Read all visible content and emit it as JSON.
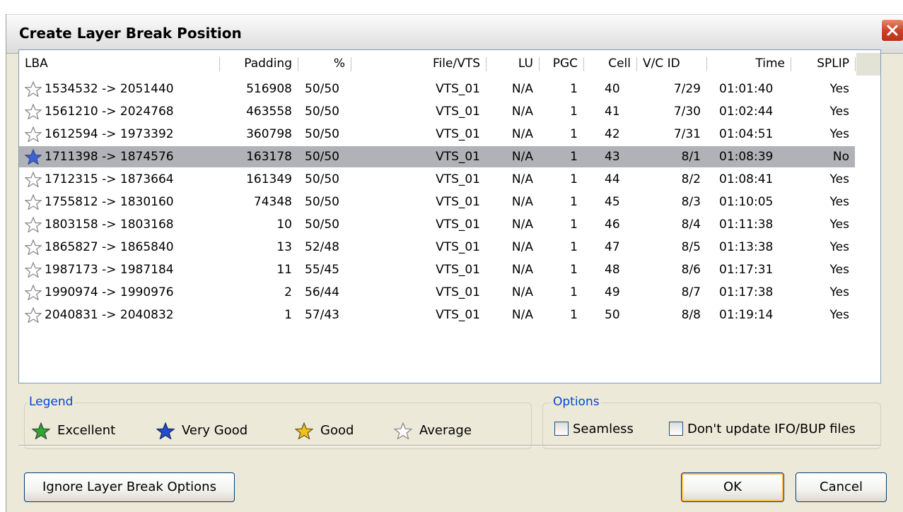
{
  "window": {
    "title": "Create Layer Break Position"
  },
  "table": {
    "columns": [
      "LBA",
      "Padding",
      "%",
      "File/VTS",
      "LU",
      "PGC",
      "Cell",
      "V/C ID",
      "Time",
      "SPLIP"
    ],
    "rows": [
      {
        "rating": "average",
        "lba": "1534532 -> 2051440",
        "padding": "516908",
        "pct": "50/50",
        "file": "VTS_01",
        "lu": "N/A",
        "pgc": "1",
        "cell": "40",
        "vcid": "7/29",
        "time": "01:01:40",
        "splip": "Yes"
      },
      {
        "rating": "average",
        "lba": "1561210 -> 2024768",
        "padding": "463558",
        "pct": "50/50",
        "file": "VTS_01",
        "lu": "N/A",
        "pgc": "1",
        "cell": "41",
        "vcid": "7/30",
        "time": "01:02:44",
        "splip": "Yes"
      },
      {
        "rating": "average",
        "lba": "1612594 -> 1973392",
        "padding": "360798",
        "pct": "50/50",
        "file": "VTS_01",
        "lu": "N/A",
        "pgc": "1",
        "cell": "42",
        "vcid": "7/31",
        "time": "01:04:51",
        "splip": "Yes"
      },
      {
        "rating": "very-good",
        "lba": "1711398 -> 1874576",
        "padding": "163178",
        "pct": "50/50",
        "file": "VTS_01",
        "lu": "N/A",
        "pgc": "1",
        "cell": "43",
        "vcid": "8/1",
        "time": "01:08:39",
        "splip": "No",
        "selected": true
      },
      {
        "rating": "average",
        "lba": "1712315 -> 1873664",
        "padding": "161349",
        "pct": "50/50",
        "file": "VTS_01",
        "lu": "N/A",
        "pgc": "1",
        "cell": "44",
        "vcid": "8/2",
        "time": "01:08:41",
        "splip": "Yes"
      },
      {
        "rating": "average",
        "lba": "1755812 -> 1830160",
        "padding": "74348",
        "pct": "50/50",
        "file": "VTS_01",
        "lu": "N/A",
        "pgc": "1",
        "cell": "45",
        "vcid": "8/3",
        "time": "01:10:05",
        "splip": "Yes"
      },
      {
        "rating": "average",
        "lba": "1803158 -> 1803168",
        "padding": "10",
        "pct": "50/50",
        "file": "VTS_01",
        "lu": "N/A",
        "pgc": "1",
        "cell": "46",
        "vcid": "8/4",
        "time": "01:11:38",
        "splip": "Yes"
      },
      {
        "rating": "average",
        "lba": "1865827 -> 1865840",
        "padding": "13",
        "pct": "52/48",
        "file": "VTS_01",
        "lu": "N/A",
        "pgc": "1",
        "cell": "47",
        "vcid": "8/5",
        "time": "01:13:38",
        "splip": "Yes"
      },
      {
        "rating": "average",
        "lba": "1987173 -> 1987184",
        "padding": "11",
        "pct": "55/45",
        "file": "VTS_01",
        "lu": "N/A",
        "pgc": "1",
        "cell": "48",
        "vcid": "8/6",
        "time": "01:17:31",
        "splip": "Yes"
      },
      {
        "rating": "average",
        "lba": "1990974 -> 1990976",
        "padding": "2",
        "pct": "56/44",
        "file": "VTS_01",
        "lu": "N/A",
        "pgc": "1",
        "cell": "49",
        "vcid": "8/7",
        "time": "01:17:38",
        "splip": "Yes"
      },
      {
        "rating": "average",
        "lba": "2040831 -> 2040832",
        "padding": "1",
        "pct": "57/43",
        "file": "VTS_01",
        "lu": "N/A",
        "pgc": "1",
        "cell": "50",
        "vcid": "8/8",
        "time": "01:19:14",
        "splip": "Yes"
      }
    ]
  },
  "legend": {
    "title": "Legend",
    "items": [
      {
        "label": "Excellent",
        "icon": "green-star-icon",
        "color": "#2fa82f"
      },
      {
        "label": "Very Good",
        "icon": "blue-star-icon",
        "color": "#1f4fd0"
      },
      {
        "label": "Good",
        "icon": "yellow-star-icon",
        "color": "#f2c21a"
      },
      {
        "label": "Average",
        "icon": "outline-star-icon",
        "color": "#ffffff"
      }
    ]
  },
  "options": {
    "title": "Options",
    "seamless": {
      "label": "Seamless",
      "checked": false
    },
    "no_update": {
      "label": "Don't update IFO/BUP files",
      "checked": false
    }
  },
  "buttons": {
    "ignore": "Ignore Layer Break Options",
    "ok": "OK",
    "cancel": "Cancel"
  },
  "colors": {
    "very_good": "#3a63d6",
    "average": "#ffffff",
    "selected_row": "#b0b2b8"
  }
}
